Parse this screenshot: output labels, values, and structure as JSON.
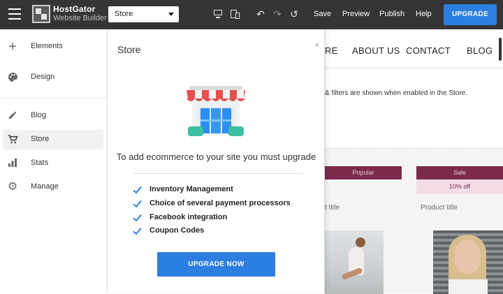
{
  "topbar": {
    "brand_line1": "HostGator",
    "brand_line2": "Website Builder",
    "page_selector": "Store",
    "save": "Save",
    "preview": "Preview",
    "publish": "Publish",
    "help": "Help",
    "upgrade": "UPGRADE"
  },
  "sidebar": {
    "items": [
      {
        "label": "Elements",
        "icon": "plus-icon"
      },
      {
        "label": "Design",
        "icon": "palette-icon"
      },
      {
        "label": "Blog",
        "icon": "pencil-icon"
      },
      {
        "label": "Store",
        "icon": "cart-icon"
      },
      {
        "label": "Stats",
        "icon": "bar-chart-icon"
      },
      {
        "label": "Manage",
        "icon": "gear-icon"
      }
    ],
    "active": "Store"
  },
  "panel": {
    "title": "Store",
    "close": "×",
    "message": "To add ecommerce to your site you must upgrade",
    "features": [
      "Inventory Management",
      "Choice of several payment processors",
      "Facebook integration",
      "Coupon Codes"
    ],
    "cta": "UPGRADE NOW"
  },
  "site": {
    "nav": [
      "RE",
      "ABOUT US",
      "CONTACT",
      "BLOG"
    ],
    "info": "& filters are shown when enabled in the Store.",
    "badge_popular": "Popular",
    "badge_sale": "Sale",
    "badge_off": "10% off",
    "product_title_1": "t title",
    "product_title_2": "Product title"
  },
  "colors": {
    "topbar": "#353535",
    "accent": "#2d7ee1",
    "badge": "#7b2a4c",
    "badge_light": "#f3dce6"
  }
}
